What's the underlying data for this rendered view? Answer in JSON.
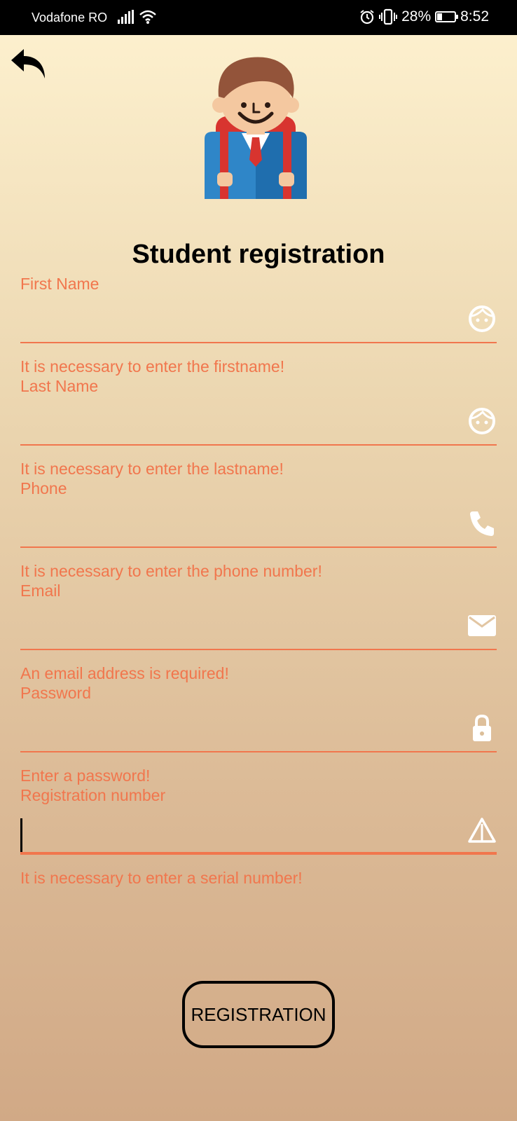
{
  "status_bar": {
    "carrier": "Vodafone RO",
    "battery_percent": "28%",
    "battery_level": 0.28,
    "time": "8:52"
  },
  "header": {
    "title": "Student registration"
  },
  "form": {
    "fields": [
      {
        "label": "First Name",
        "value": "",
        "error": "It is necessary to enter the firstname!",
        "icon": "face-icon"
      },
      {
        "label": "Last Name",
        "value": "",
        "error": "It is necessary to enter the lastname!",
        "icon": "face-icon"
      },
      {
        "label": "Phone",
        "value": "",
        "error": "It is necessary to enter the phone number!",
        "icon": "phone-icon"
      },
      {
        "label": "Email",
        "value": "",
        "error": "An email address is required!",
        "icon": "mail-icon"
      },
      {
        "label": "Password",
        "value": "",
        "error": "Enter a password!",
        "icon": "lock-icon"
      },
      {
        "label": "Registration number",
        "value": "",
        "error": "It is necessary to enter a serial number!",
        "icon": "warning-icon"
      }
    ],
    "submit_label": "REGISTRATION"
  },
  "colors": {
    "accent": "#f1764d",
    "icon": "#ffffff",
    "background_top": "#fef2d0",
    "background_bottom": "#d1a986"
  }
}
